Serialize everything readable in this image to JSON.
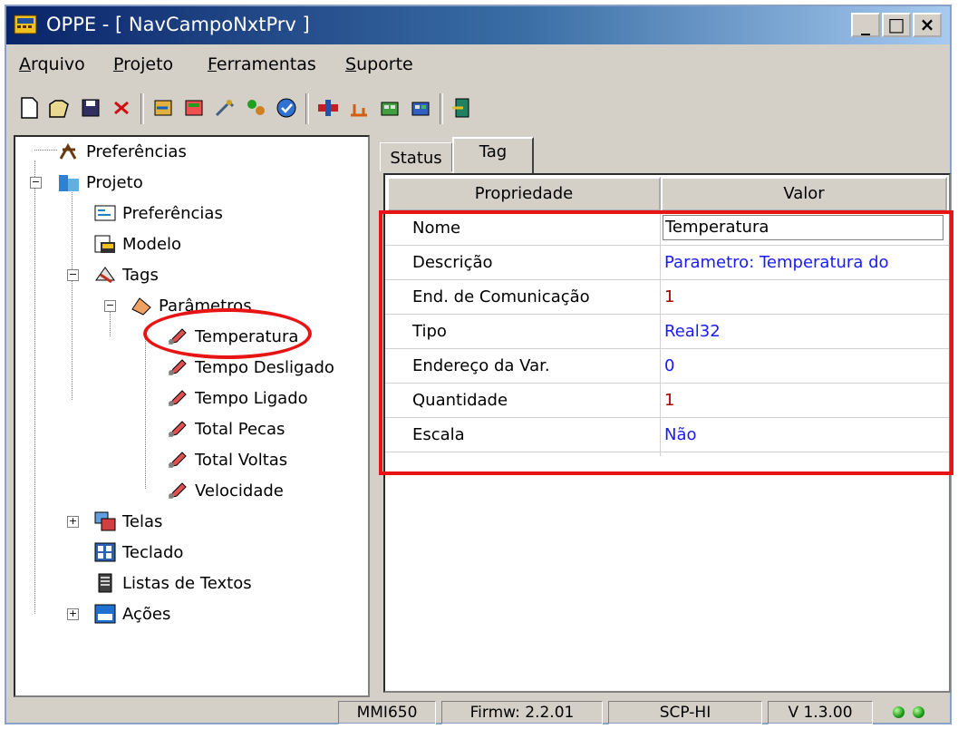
{
  "window": {
    "title": "OPPE - [ NavCampoNxtPrv ]",
    "minimize_glyph": "_",
    "maximize_glyph": "□",
    "close_glyph": "×"
  },
  "menu": {
    "items": [
      {
        "label": "Arquivo",
        "hotkey": "A"
      },
      {
        "label": "Projeto",
        "hotkey": "P"
      },
      {
        "label": "Ferramentas",
        "hotkey": "F"
      },
      {
        "label": "Suporte",
        "hotkey": "S"
      }
    ]
  },
  "toolbar": {
    "buttons": [
      "new-file-icon",
      "open-folder-icon",
      "save-icon",
      "delete-icon",
      "import-icon",
      "export-icon",
      "tool-icon",
      "wizard-icon",
      "compile-icon",
      "connect-icon",
      "transfer-icon",
      "upload-icon",
      "download-icon",
      "exit-icon"
    ]
  },
  "tree": {
    "items": [
      {
        "label": "Preferências",
        "icon": "preferences-icon"
      },
      {
        "label": "Projeto",
        "icon": "project-icon"
      },
      {
        "label": "Preferências",
        "icon": "project-preferences-icon"
      },
      {
        "label": "Modelo",
        "icon": "model-icon"
      },
      {
        "label": "Tags",
        "icon": "tags-icon"
      },
      {
        "label": "Parâmetros",
        "icon": "parameters-icon"
      },
      {
        "label": "Temperatura",
        "icon": "tag-icon"
      },
      {
        "label": "Tempo Desligado",
        "icon": "tag-icon"
      },
      {
        "label": "Tempo Ligado",
        "icon": "tag-icon"
      },
      {
        "label": "Total Pecas",
        "icon": "tag-icon"
      },
      {
        "label": "Total Voltas",
        "icon": "tag-icon"
      },
      {
        "label": "Velocidade",
        "icon": "tag-icon"
      },
      {
        "label": "Telas",
        "icon": "screens-icon"
      },
      {
        "label": "Teclado",
        "icon": "keyboard-icon"
      },
      {
        "label": "Listas de Textos",
        "icon": "text-lists-icon"
      },
      {
        "label": "Ações",
        "icon": "actions-icon"
      }
    ],
    "selected": "Temperatura"
  },
  "tabs": {
    "status": "Status",
    "tag": "Tag",
    "active": "Tag"
  },
  "grid": {
    "headers": {
      "property": "Propriedade",
      "value": "Valor"
    },
    "rows": [
      {
        "property": "Nome",
        "value": "Temperatura",
        "value_color": "#000000"
      },
      {
        "property": "Descrição",
        "value": "Parametro: Temperatura do",
        "value_color": "#1a1aff"
      },
      {
        "property": "End. de Comunicação",
        "value": "1",
        "value_color": "#a00000"
      },
      {
        "property": "Tipo",
        "value": "Real32",
        "value_color": "#1a1aff"
      },
      {
        "property": "Endereço da Var.",
        "value": "0",
        "value_color": "#1a1aff"
      },
      {
        "property": "Quantidade",
        "value": "1",
        "value_color": "#a00000"
      },
      {
        "property": "Escala",
        "value": "Não",
        "value_color": "#1a1aff"
      }
    ]
  },
  "statusbar": {
    "model": "MMI650",
    "firmware": "Firmw: 2.2.01",
    "protocol": "SCP-HI",
    "version": "V 1.3.00",
    "leds": [
      "status-led-icon",
      "connection-led-icon"
    ]
  },
  "colors": {
    "annotation_red": "#e81414",
    "title_start": "#0a246a",
    "title_end": "#a6caf0",
    "panel": "#d4d0c8"
  }
}
